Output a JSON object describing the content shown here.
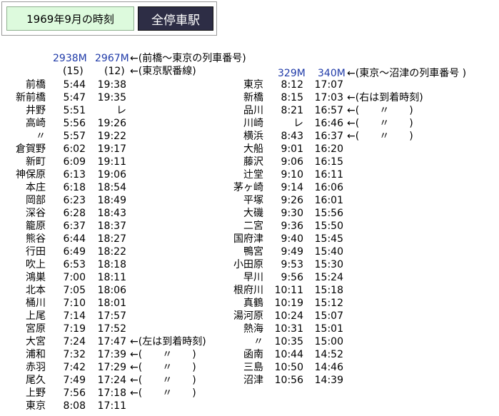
{
  "header": {
    "title": "1969年9月の時刻",
    "tab_all_stations": "全停車駅"
  },
  "left_train_numbers": [
    "2938M",
    "2967M"
  ],
  "left_train_numbers_note": "←(前橋～東京の列車番号)",
  "left_platforms": [
    "(15)",
    "(12)"
  ],
  "left_platforms_note": "←(東京駅番線)",
  "right_train_numbers": [
    "329M",
    "340M"
  ],
  "right_train_numbers_note": "←(東京～沼津の列車番号 )",
  "left_rows": [
    {
      "station": "前橋",
      "t1": "5:44",
      "t2": "19:38",
      "note": ""
    },
    {
      "station": "新前橋",
      "t1": "5:47",
      "t2": "19:35",
      "note": ""
    },
    {
      "station": "井野",
      "t1": "5:51",
      "t2": "レ",
      "note": ""
    },
    {
      "station": "高崎",
      "t1": "5:56",
      "t2": "19:26",
      "note": ""
    },
    {
      "station": "〃",
      "t1": "5:57",
      "t2": "19:22",
      "note": ""
    },
    {
      "station": "倉賀野",
      "t1": "6:02",
      "t2": "19:17",
      "note": ""
    },
    {
      "station": "新町",
      "t1": "6:09",
      "t2": "19:11",
      "note": ""
    },
    {
      "station": "神保原",
      "t1": "6:13",
      "t2": "19:06",
      "note": ""
    },
    {
      "station": "本庄",
      "t1": "6:18",
      "t2": "18:54",
      "note": ""
    },
    {
      "station": "岡部",
      "t1": "6:23",
      "t2": "18:49",
      "note": ""
    },
    {
      "station": "深谷",
      "t1": "6:28",
      "t2": "18:43",
      "note": ""
    },
    {
      "station": "籠原",
      "t1": "6:37",
      "t2": "18:37",
      "note": ""
    },
    {
      "station": "熊谷",
      "t1": "6:44",
      "t2": "18:27",
      "note": ""
    },
    {
      "station": "行田",
      "t1": "6:49",
      "t2": "18:22",
      "note": ""
    },
    {
      "station": "吹上",
      "t1": "6:53",
      "t2": "18:18",
      "note": ""
    },
    {
      "station": "鴻巣",
      "t1": "7:00",
      "t2": "18:11",
      "note": ""
    },
    {
      "station": "北本",
      "t1": "7:05",
      "t2": "18:06",
      "note": ""
    },
    {
      "station": "桶川",
      "t1": "7:10",
      "t2": "18:01",
      "note": ""
    },
    {
      "station": "上尾",
      "t1": "7:14",
      "t2": "17:57",
      "note": ""
    },
    {
      "station": "宮原",
      "t1": "7:19",
      "t2": "17:52",
      "note": ""
    },
    {
      "station": "大宮",
      "t1": "7:24",
      "t2": "17:47",
      "note": "←(左は到着時刻)"
    },
    {
      "station": "浦和",
      "t1": "7:32",
      "t2": "17:39",
      "note": "←(　　〃　　)"
    },
    {
      "station": "赤羽",
      "t1": "7:42",
      "t2": "17:29",
      "note": "←(　　〃　　)"
    },
    {
      "station": "尾久",
      "t1": "7:49",
      "t2": "17:24",
      "note": "←(　　〃　　)"
    },
    {
      "station": "上野",
      "t1": "7:56",
      "t2": "17:18",
      "note": "←(　　〃　　)"
    },
    {
      "station": "東京",
      "t1": "8:08",
      "t2": "17:11",
      "note": ""
    }
  ],
  "right_rows": [
    {
      "station": "東京",
      "t1": "8:12",
      "t2": "17:07",
      "note": ""
    },
    {
      "station": "新橋",
      "t1": "8:15",
      "t2": "17:03",
      "note": "←(右は到着時刻)"
    },
    {
      "station": "品川",
      "t1": "8:21",
      "t2": "16:57",
      "note": "←(　　〃　　)"
    },
    {
      "station": "川崎",
      "t1": "レ",
      "t2": "16:46",
      "note": "←(　　〃　　)"
    },
    {
      "station": "横浜",
      "t1": "8:43",
      "t2": "16:37",
      "note": "←(　　〃　　)"
    },
    {
      "station": "大船",
      "t1": "9:01",
      "t2": "16:20",
      "note": ""
    },
    {
      "station": "藤沢",
      "t1": "9:06",
      "t2": "16:15",
      "note": ""
    },
    {
      "station": "辻堂",
      "t1": "9:10",
      "t2": "16:11",
      "note": ""
    },
    {
      "station": "茅ヶ崎",
      "t1": "9:14",
      "t2": "16:06",
      "note": ""
    },
    {
      "station": "平塚",
      "t1": "9:26",
      "t2": "16:01",
      "note": ""
    },
    {
      "station": "大磯",
      "t1": "9:30",
      "t2": "15:56",
      "note": ""
    },
    {
      "station": "二宮",
      "t1": "9:36",
      "t2": "15:50",
      "note": ""
    },
    {
      "station": "国府津",
      "t1": "9:40",
      "t2": "15:45",
      "note": ""
    },
    {
      "station": "鴨宮",
      "t1": "9:49",
      "t2": "15:40",
      "note": ""
    },
    {
      "station": "小田原",
      "t1": "9:53",
      "t2": "15:30",
      "note": ""
    },
    {
      "station": "早川",
      "t1": "9:56",
      "t2": "15:24",
      "note": ""
    },
    {
      "station": "根府川",
      "t1": "10:11",
      "t2": "15:18",
      "note": ""
    },
    {
      "station": "真鶴",
      "t1": "10:19",
      "t2": "15:12",
      "note": ""
    },
    {
      "station": "湯河原",
      "t1": "10:24",
      "t2": "15:07",
      "note": ""
    },
    {
      "station": "熱海",
      "t1": "10:31",
      "t2": "15:01",
      "note": ""
    },
    {
      "station": "〃",
      "t1": "10:35",
      "t2": "15:00",
      "note": ""
    },
    {
      "station": "函南",
      "t1": "10:44",
      "t2": "14:52",
      "note": ""
    },
    {
      "station": "三島",
      "t1": "10:50",
      "t2": "14:46",
      "note": ""
    },
    {
      "station": "沼津",
      "t1": "10:56",
      "t2": "14:39",
      "note": ""
    }
  ]
}
